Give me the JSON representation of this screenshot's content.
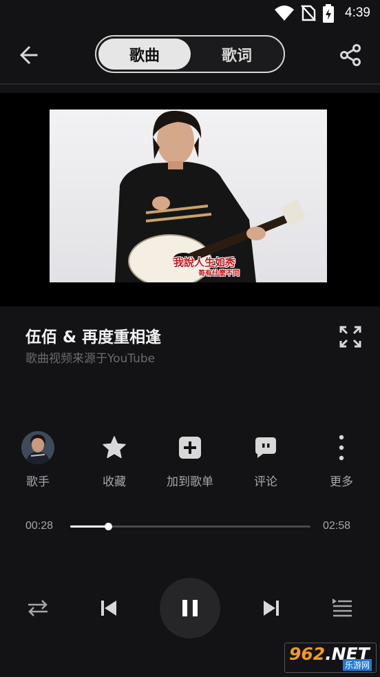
{
  "status_bar": {
    "time": "4:39",
    "icons": [
      "wifi-icon",
      "no-sim-icon",
      "battery-charging-icon"
    ]
  },
  "header": {
    "back_icon": "arrow-left-icon",
    "tabs": [
      {
        "label": "歌曲",
        "selected": true
      },
      {
        "label": "歌词",
        "selected": false
      }
    ],
    "share_icon": "share-icon"
  },
  "video": {
    "subtitle_line1": "我說人生如秀",
    "subtitle_line2": "哥有什麼不同"
  },
  "song": {
    "title": "伍佰 &  再度重相逢",
    "source": "歌曲视频来源于YouTube",
    "fullscreen_icon": "fullscreen-expand-icon"
  },
  "actions": [
    {
      "label": "歌手",
      "icon": "artist-avatar"
    },
    {
      "label": "收藏",
      "icon": "star-icon"
    },
    {
      "label": "加到歌单",
      "icon": "add-to-playlist-icon"
    },
    {
      "label": "评论",
      "icon": "comment-icon"
    },
    {
      "label": "更多",
      "icon": "more-vertical-icon"
    }
  ],
  "progress": {
    "current": "00:28",
    "total": "02:58",
    "fraction": 0.157
  },
  "controls": {
    "repeat_icon": "repeat-icon",
    "prev_icon": "skip-previous-icon",
    "play_state_icon": "pause-icon",
    "next_icon": "skip-next-icon",
    "playlist_icon": "playlist-icon"
  },
  "watermark": {
    "main": "962.NET",
    "sub": "乐游网"
  },
  "colors": {
    "background": "#131315",
    "accent_text": "#ffffff",
    "secondary_text": "#a6a6aa",
    "watermark_orange": "#f39a1e"
  }
}
